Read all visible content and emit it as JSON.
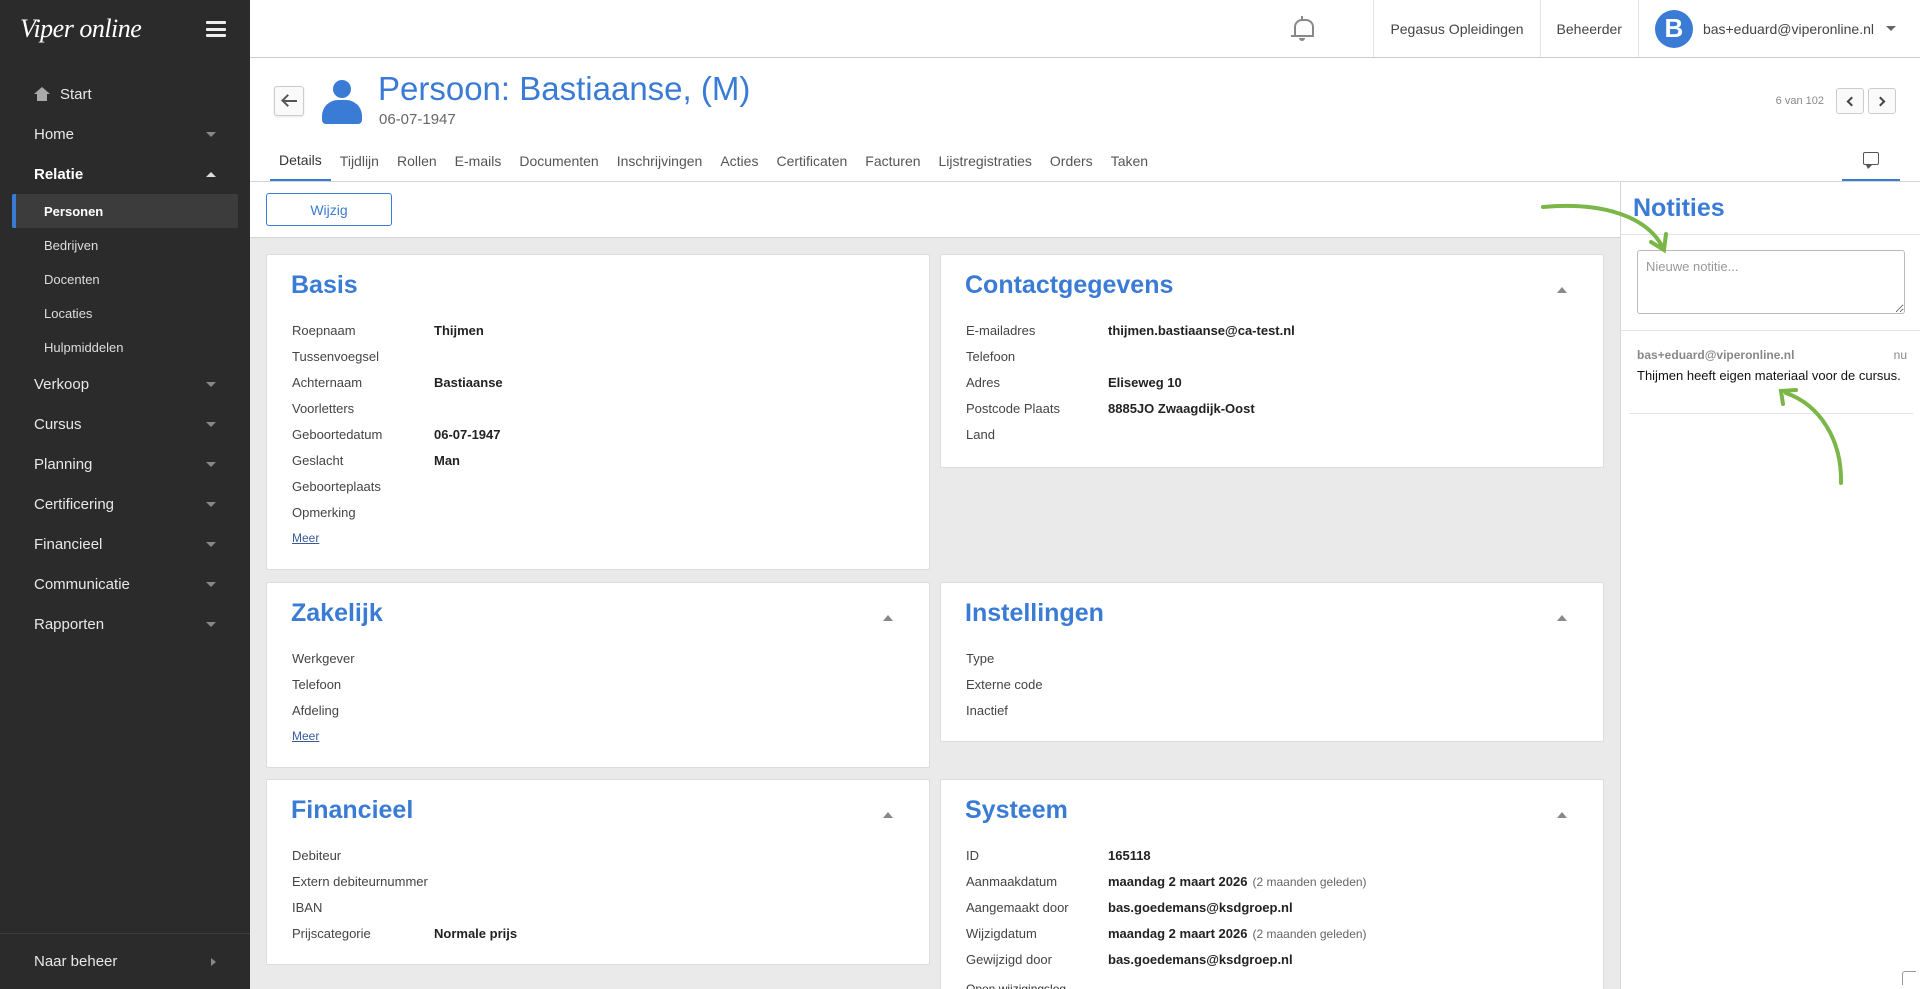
{
  "sidebar": {
    "logo": "Viper online",
    "items": [
      {
        "label": "Start"
      },
      {
        "label": "Home"
      },
      {
        "label": "Relatie"
      },
      {
        "label": "Verkoop"
      },
      {
        "label": "Cursus"
      },
      {
        "label": "Planning"
      },
      {
        "label": "Certificering"
      },
      {
        "label": "Financieel"
      },
      {
        "label": "Communicatie"
      },
      {
        "label": "Rapporten"
      }
    ],
    "relatie_sub": [
      "Personen",
      "Bedrijven",
      "Docenten",
      "Locaties",
      "Hulpmiddelen"
    ],
    "bottom_label": "Naar beheer"
  },
  "topbar": {
    "org": "Pegasus Opleidingen",
    "role": "Beheerder",
    "avatar_letter": "B",
    "user": "bas+eduard@viperonline.nl"
  },
  "header": {
    "title": "Persoon: Bastiaanse, (M)",
    "subtitle": "06-07-1947",
    "pager": "6 van 102",
    "tabs": [
      "Details",
      "Tijdlijn",
      "Rollen",
      "E-mails",
      "Documenten",
      "Inschrijvingen",
      "Acties",
      "Certificaten",
      "Facturen",
      "Lijstregistraties",
      "Orders",
      "Taken"
    ]
  },
  "toolbar": {
    "edit_label": "Wijzig"
  },
  "cards": {
    "basis": {
      "title": "Basis",
      "fields": [
        {
          "k": "Roepnaam",
          "v": "Thijmen"
        },
        {
          "k": "Tussenvoegsel",
          "v": ""
        },
        {
          "k": "Achternaam",
          "v": "Bastiaanse"
        },
        {
          "k": "Voorletters",
          "v": ""
        },
        {
          "k": "Geboortedatum",
          "v": "06-07-1947"
        },
        {
          "k": "Geslacht",
          "v": "Man"
        },
        {
          "k": "Geboorteplaats",
          "v": ""
        },
        {
          "k": "Opmerking",
          "v": ""
        }
      ],
      "more": "Meer"
    },
    "contact": {
      "title": "Contactgegevens",
      "fields": [
        {
          "k": "E-mailadres",
          "v": "thijmen.bastiaanse@ca-test.nl"
        },
        {
          "k": "Telefoon",
          "v": ""
        },
        {
          "k": "Adres",
          "v": "Eliseweg 10"
        },
        {
          "k": "Postcode Plaats",
          "v": "8885JO Zwaagdijk-Oost"
        },
        {
          "k": "Land",
          "v": ""
        }
      ]
    },
    "zakelijk": {
      "title": "Zakelijk",
      "fields": [
        {
          "k": "Werkgever",
          "v": ""
        },
        {
          "k": "Telefoon",
          "v": ""
        },
        {
          "k": "Afdeling",
          "v": ""
        }
      ],
      "more": "Meer"
    },
    "instellingen": {
      "title": "Instellingen",
      "fields": [
        {
          "k": "Type",
          "v": ""
        },
        {
          "k": "Externe code",
          "v": ""
        },
        {
          "k": "Inactief",
          "v": ""
        }
      ]
    },
    "financieel": {
      "title": "Financieel",
      "fields": [
        {
          "k": "Debiteur",
          "v": ""
        },
        {
          "k": "Extern debiteurnummer",
          "v": ""
        },
        {
          "k": "IBAN",
          "v": ""
        },
        {
          "k": "Prijscategorie",
          "v": "Normale prijs"
        }
      ]
    },
    "systeem": {
      "title": "Systeem",
      "fields": [
        {
          "k": "ID",
          "v": "165118",
          "m": ""
        },
        {
          "k": "Aanmaakdatum",
          "v": "maandag 2 maart 2026",
          "m": "(2 maanden geleden)"
        },
        {
          "k": "Aangemaakt door",
          "v": "bas.goedemans@ksdgroep.nl",
          "m": ""
        },
        {
          "k": "Wijzigdatum",
          "v": "maandag 2 maart 2026",
          "m": "(2 maanden geleden)"
        },
        {
          "k": "Gewijzigd door",
          "v": "bas.goedemans@ksdgroep.nl",
          "m": ""
        }
      ],
      "log_link": "Open wijzigingslog"
    }
  },
  "notes": {
    "title": "Notities",
    "placeholder": "Nieuwe notitie...",
    "items": [
      {
        "author": "bas+eduard@viperonline.nl",
        "time": "nu",
        "text": "Thijmen heeft eigen materiaal voor de cursus."
      }
    ]
  },
  "colors": {
    "accent": "#3a7bd5",
    "sidebar": "#2b2b2b",
    "annotation_arrow": "#7ab648"
  }
}
